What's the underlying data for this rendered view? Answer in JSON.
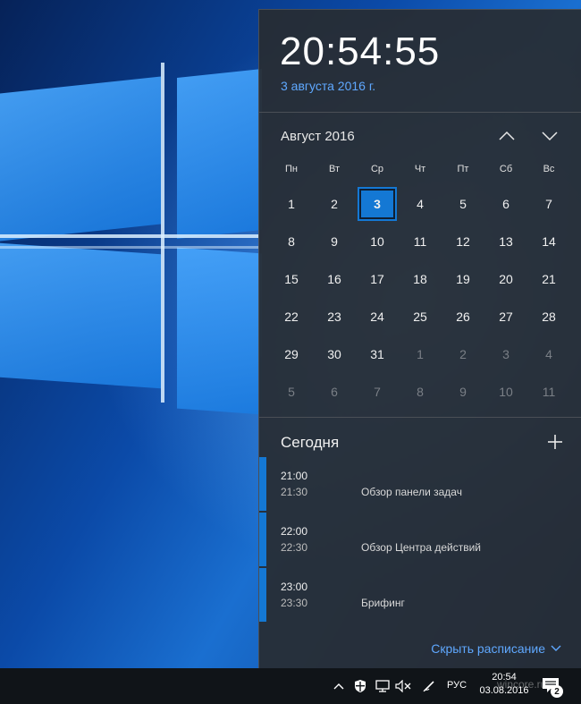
{
  "clock": {
    "time": "20:54:55",
    "date_long": "3 августа 2016 г."
  },
  "calendar": {
    "month_label": "Август 2016",
    "weekdays": [
      "Пн",
      "Вт",
      "Ср",
      "Чт",
      "Пт",
      "Сб",
      "Вс"
    ],
    "weeks": [
      [
        "1",
        "2",
        "3",
        "4",
        "5",
        "6",
        "7"
      ],
      [
        "8",
        "9",
        "10",
        "11",
        "12",
        "13",
        "14"
      ],
      [
        "15",
        "16",
        "17",
        "18",
        "19",
        "20",
        "21"
      ],
      [
        "22",
        "23",
        "24",
        "25",
        "26",
        "27",
        "28"
      ],
      [
        "29",
        "30",
        "31",
        "1",
        "2",
        "3",
        "4"
      ],
      [
        "5",
        "6",
        "7",
        "8",
        "9",
        "10",
        "11"
      ]
    ],
    "today_index": 2,
    "current_month_count": 31,
    "accent_color": "#1478d4"
  },
  "agenda": {
    "title": "Сегодня",
    "events": [
      {
        "start": "21:00",
        "end": "21:30",
        "title": "Обзор панели задач"
      },
      {
        "start": "22:00",
        "end": "22:30",
        "title": "Обзор Центра действий"
      },
      {
        "start": "23:00",
        "end": "23:30",
        "title": "Брифинг"
      }
    ],
    "hide_label": "Скрыть расписание"
  },
  "taskbar": {
    "language": "РУС",
    "time": "20:54",
    "date": "03.08.2016",
    "notification_count": "2",
    "watermark": "wincore.ru"
  }
}
